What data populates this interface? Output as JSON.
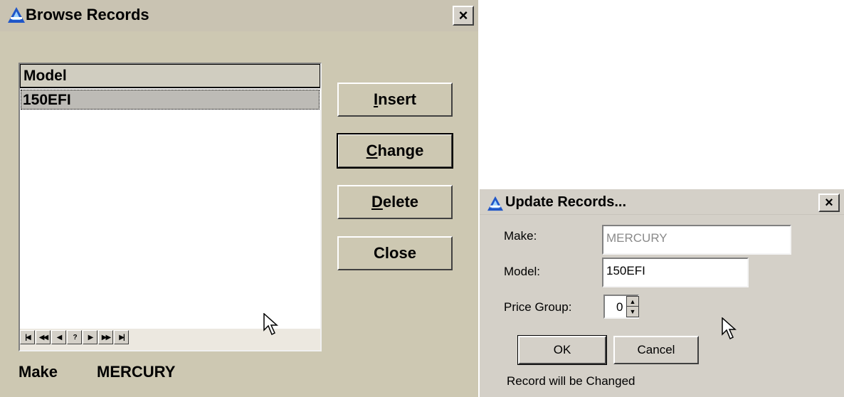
{
  "browse": {
    "title": "Browse Records",
    "close_glyph": "×",
    "list": {
      "column_header": "Model",
      "rows": [
        "150EFI"
      ],
      "nav_buttons": [
        "|◀",
        "◀◀",
        "◀",
        "?",
        "▶",
        "▶▶",
        "▶|"
      ]
    },
    "buttons": {
      "insert_key": "I",
      "insert_rest": "nsert",
      "change_key": "C",
      "change_rest": "hange",
      "delete_key": "D",
      "delete_rest": "elete",
      "close": "Close"
    },
    "make_label": "Make",
    "make_value": "MERCURY"
  },
  "update": {
    "title": "Update Records...",
    "close_glyph": "×",
    "labels": {
      "make": "Make:",
      "model": "Model:",
      "price_group": "Price Group:"
    },
    "fields": {
      "make": "MERCURY",
      "model": "150EFI",
      "price_group": "0"
    },
    "buttons": {
      "ok": "OK",
      "cancel": "Cancel"
    },
    "status": "Record will be Changed"
  },
  "icons": {
    "app_icon": "app-logo-icon",
    "mouse_pointer": "arrow-cursor-icon"
  },
  "colors": {
    "browse_window_bg": "#cdc8b2",
    "dialog_bg": "#d4d0c8",
    "selected_row_bg": "#bdbbb6",
    "app_icon_blue": "#1f56c8"
  }
}
